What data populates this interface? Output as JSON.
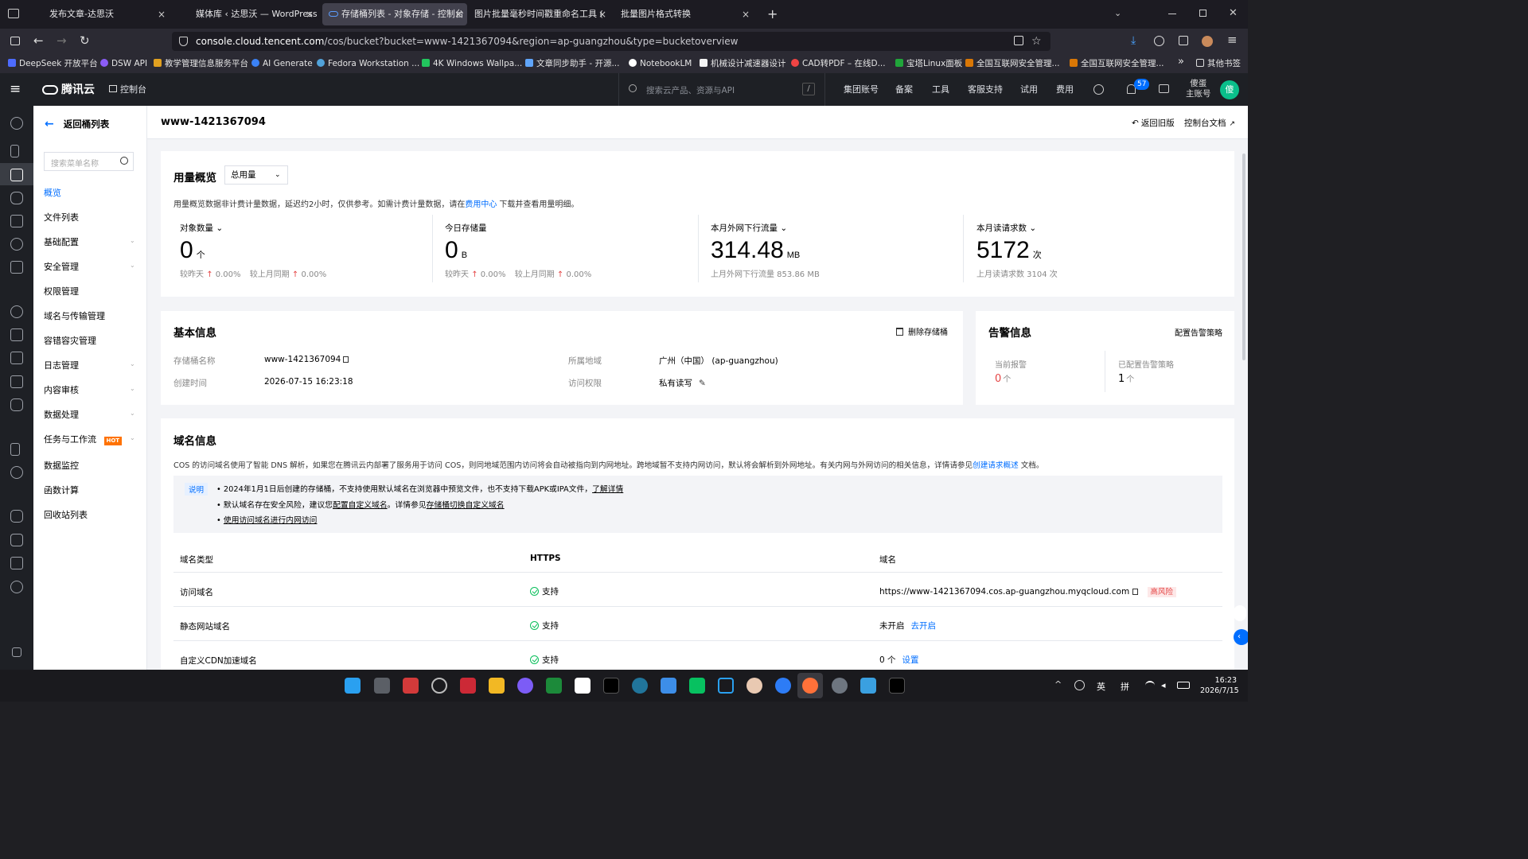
{
  "browser": {
    "tabs": [
      {
        "label": "发布文章-达思沃",
        "close": "×"
      },
      {
        "label": "媒体库 ‹ 达思沃 — WordPress",
        "close": "×"
      },
      {
        "label": "存储桶列表 - 对象存储 - 控制台",
        "close": "×"
      },
      {
        "label": "图片批量毫秒时间戳重命名工具 (",
        "close": "×"
      },
      {
        "label": "批量图片格式转换",
        "close": "×"
      }
    ],
    "new_tab": "+",
    "url_host": "console.cloud.tencent.com",
    "url_path": "/cos/bucket?bucket=www-1421367094&region=ap-guangzhou&type=bucketoverview",
    "bookmarks": [
      "DeepSeek 开放平台",
      "DSW API",
      "教学管理信息服务平台",
      "AI Generate",
      "Fedora Workstation ...",
      "4K Windows Wallpa...",
      "文章同步助手 - 开源...",
      "NotebookLM",
      "机械设计减速器设计",
      "CAD转PDF – 在线D...",
      "宝塔Linux面板",
      "全国互联网安全管理...",
      "全国互联网安全管理..."
    ],
    "other_bookmarks": "其他书签",
    "bookmark_more": "»"
  },
  "topnav": {
    "brand": "腾讯云",
    "console": "控制台",
    "search_placeholder": "搜索云产品、资源与API",
    "search_shortcut": "/",
    "items": [
      "集团账号",
      "备案",
      "工具",
      "客服支持",
      "试用",
      "费用"
    ],
    "notification_count": "57",
    "account_line1": "傻蛋",
    "account_line2": "主账号",
    "avatar_text": "傻"
  },
  "sidebar": {
    "back": "返回桶列表",
    "search_placeholder": "搜索菜单名称",
    "items": [
      {
        "label": "概览",
        "active": true,
        "expandable": false
      },
      {
        "label": "文件列表",
        "expandable": false
      },
      {
        "label": "基础配置",
        "expandable": true
      },
      {
        "label": "安全管理",
        "expandable": true
      },
      {
        "label": "权限管理",
        "expandable": false
      },
      {
        "label": "域名与传输管理",
        "expandable": false
      },
      {
        "label": "容错容灾管理",
        "expandable": false
      },
      {
        "label": "日志管理",
        "expandable": true
      },
      {
        "label": "内容审核",
        "expandable": true
      },
      {
        "label": "数据处理",
        "expandable": true
      },
      {
        "label": "任务与工作流",
        "expandable": true,
        "badge": "HOT"
      },
      {
        "label": "数据监控",
        "expandable": false
      },
      {
        "label": "函数计算",
        "expandable": false
      },
      {
        "label": "回收站列表",
        "expandable": false
      }
    ]
  },
  "page": {
    "title": "www-1421367094",
    "back_old": "返回旧版",
    "docs": "控制台文档"
  },
  "usage": {
    "title": "用量概览",
    "select": "总用量",
    "note_prefix": "用量概览数据非计费计量数据，延迟约2小时，仅供参考。如需计费计量数据，请在",
    "note_link": "费用中心",
    "note_suffix": "下载并查看用量明细。",
    "stats": [
      {
        "label": "对象数量",
        "dropdown": true,
        "value": "0",
        "unit": "个",
        "sub1": "较昨天",
        "sub1_val": "0.00%",
        "sub2": "较上月同期",
        "sub2_val": "0.00%"
      },
      {
        "label": "今日存储量",
        "dropdown": false,
        "value": "0",
        "unit": "B",
        "sub1": "较昨天",
        "sub1_val": "0.00%",
        "sub2": "较上月同期",
        "sub2_val": "0.00%"
      },
      {
        "label": "本月外网下行流量",
        "dropdown": true,
        "value": "314.48",
        "unit": "MB",
        "sub": "上月外网下行流量 853.86 MB"
      },
      {
        "label": "本月读请求数",
        "dropdown": true,
        "value": "5172",
        "unit": "次",
        "sub": "上月读请求数 3104 次"
      }
    ]
  },
  "basic": {
    "title": "基本信息",
    "delete": "删除存储桶",
    "name_label": "存储桶名称",
    "name_value": "www-1421367094",
    "region_label": "所属地域",
    "region_value": "广州（中国） (ap-guangzhou)",
    "created_label": "创建时间",
    "created_value": "2026-07-15 16:23:18",
    "access_label": "访问权限",
    "access_value": "私有读写"
  },
  "alarm": {
    "title": "告警信息",
    "config": "配置告警策略",
    "current_label": "当前报警",
    "current_value": "0",
    "current_unit": "个",
    "policy_label": "已配置告警策略",
    "policy_value": "1",
    "policy_unit": "个"
  },
  "domain": {
    "title": "域名信息",
    "desc_prefix": "COS 的访问域名使用了智能 DNS 解析，如果您在腾讯云内部署了服务用于访问 COS，则同地域范围内访问将会自动被指向到内网地址。跨地域暂不支持内网访问，默认将会解析到外网地址。有关内网与外网访问的相关信息，详情请参见",
    "desc_link": "创建请求概述",
    "desc_suffix": "文档。",
    "notice_tag": "说明",
    "notice_1": "2024年1月1日后创建的存储桶，不支持使用默认域名在浏览器中预览文件，也不支持下载APK或IPA文件，",
    "notice_1_link": "了解详情",
    "notice_2_prefix": "默认域名存在安全风险，建议您",
    "notice_2_link1": "配置自定义域名",
    "notice_2_mid": "。详情参见",
    "notice_2_link2": "存储桶切换自定义域名",
    "notice_3_link": "使用访问域名进行内网访问",
    "headers": [
      "域名类型",
      "HTTPS",
      "域名"
    ],
    "rows": [
      {
        "type": "访问域名",
        "https": "支持",
        "domain": "https://www-1421367094.cos.ap-guangzhou.myqcloud.com",
        "tag": "高风险"
      },
      {
        "type": "静态网站域名",
        "https": "支持",
        "domain": "未开启",
        "action": "去开启"
      },
      {
        "type": "自定义CDN加速域名",
        "https": "支持",
        "domain": "0 个",
        "action": "设置"
      }
    ]
  },
  "taskbar": {
    "ime1": "英",
    "ime2": "拼",
    "time": "16:23",
    "date": "2026/7/15"
  },
  "colors": {
    "accent": "#006eff",
    "danger": "#e54545",
    "success": "#0abf5b",
    "hot": "#ff7200"
  }
}
